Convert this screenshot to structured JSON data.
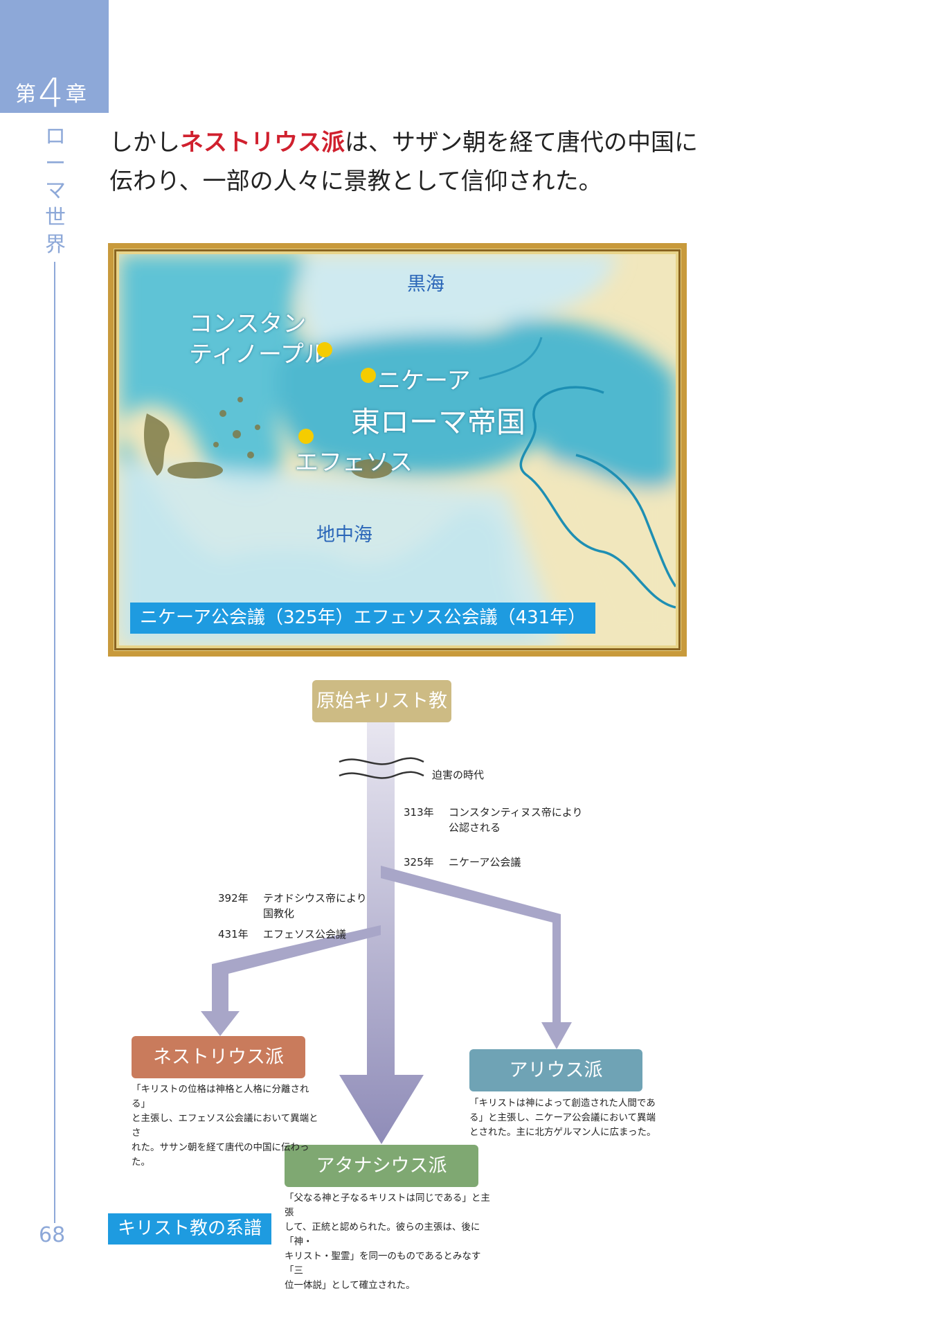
{
  "chapter": {
    "prefix": "第",
    "number": "4",
    "suffix": "章",
    "section": "ローマ世界"
  },
  "page_number": "68",
  "lead": {
    "before": "しかし",
    "highlight": "ネストリウス派",
    "after": "は、サザン朝を経て唐代の中国に伝わり、一部の人々に景教として信仰された。"
  },
  "map": {
    "black_sea": "黒海",
    "mediterranean": "地中海",
    "empire": "東ローマ帝国",
    "constantinople_line1": "コンスタン",
    "constantinople_line2": "ティノープル",
    "nicaea": "ニケーア",
    "ephesus": "エフェソス",
    "caption": "ニケーア公会議（325年）エフェソス公会議（431年）",
    "colors": {
      "sea": "#4fb8cf",
      "land": "#f1e7bd",
      "city": "#f5cc00",
      "river": "#1e8fb3",
      "frame": "#c89a3c"
    }
  },
  "genealogy": {
    "label": "キリスト教の系譜",
    "origin": "原始キリスト教",
    "persecution": "迫害の時代",
    "events": {
      "e313_year": "313年",
      "e313_text1": "コンスタンティヌス帝により",
      "e313_text2": "公認される",
      "e325_year": "325年",
      "e325_text": "ニケーア公会議",
      "e392_year": "392年",
      "e392_text1": "テオドシウス帝により",
      "e392_text2": "国教化",
      "e431_year": "431年",
      "e431_text": "エフェソス公会議"
    },
    "nestorian": {
      "name": "ネストリウス派",
      "desc1": "「キリストの位格は神格と人格に分離される」",
      "desc2": "と主張し、エフェソス公会議において異端とさ",
      "desc3": "れた。ササン朝を経て唐代の中国に伝わった。"
    },
    "arian": {
      "name": "アリウス派",
      "desc1": "「キリストは神によって創造された人間であ",
      "desc2": "る」と主張し、ニケーア公会議において異端",
      "desc3": "とされた。主に北方ゲルマン人に広まった。"
    },
    "athanasian": {
      "name": "アタナシウス派",
      "desc1": "「父なる神と子なるキリストは同じである」と主張",
      "desc2": "して、正統と認められた。彼らの主張は、後に「神・",
      "desc3": "キリスト・聖霊」を同一のものであるとみなす「三",
      "desc4": "位一体説」として確立された。"
    },
    "colors": {
      "origin": "#cdbb84",
      "nestorian": "#c97b5c",
      "arian": "#6fa3b5",
      "athanasian": "#7fa872",
      "arrow": "#a8a6c8"
    }
  }
}
